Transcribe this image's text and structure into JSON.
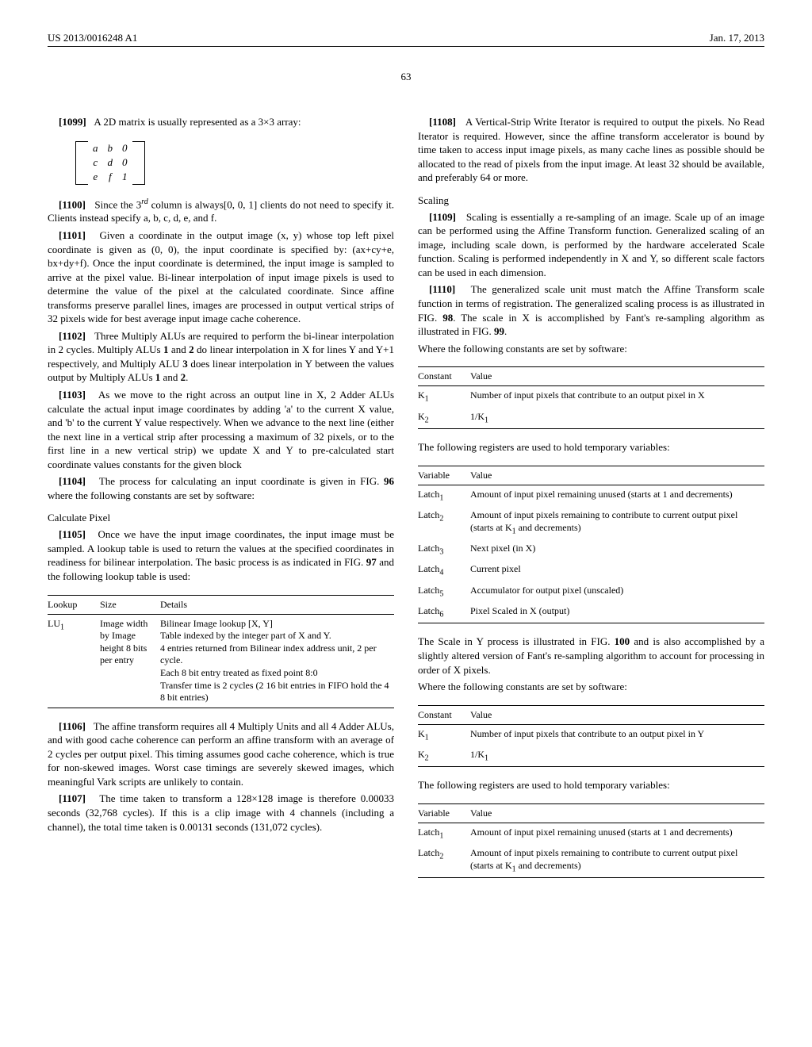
{
  "header": {
    "pub_number": "US 2013/0016248 A1",
    "pub_date": "Jan. 17, 2013",
    "page": "63"
  },
  "left": {
    "p1099": "A 2D matrix is usually represented as a 3×3 array:",
    "matrix": [
      [
        "a",
        "b",
        "0"
      ],
      [
        "c",
        "d",
        "0"
      ],
      [
        "e",
        "f",
        "1"
      ]
    ],
    "p1100": "Since the 3rd column is always[0, 0, 1] clients do not need to specify it. Clients instead specify a, b, c, d, e, and f.",
    "p1101": "Given a coordinate in the output image (x, y) whose top left pixel coordinate is given as (0, 0), the input coordinate is specified by: (ax+cy+e, bx+dy+f). Once the input coordinate is determined, the input image is sampled to arrive at the pixel value. Bi-linear interpolation of input image pixels is used to determine the value of the pixel at the calculated coordinate. Since affine transforms preserve parallel lines, images are processed in output vertical strips of 32 pixels wide for best average input image cache coherence.",
    "p1102": "Three Multiply ALUs are required to perform the bi-linear interpolation in 2 cycles. Multiply ALUs 1 and 2 do linear interpolation in X for lines Y and Y+1 respectively, and Multiply ALU 3 does linear interpolation in Y between the values output by Multiply ALUs 1 and 2.",
    "p1103": "As we move to the right across an output line in X, 2 Adder ALUs calculate the actual input image coordinates by adding 'a' to the current X value, and 'b' to the current Y value respectively. When we advance to the next line (either the next line in a vertical strip after processing a maximum of 32 pixels, or to the first line in a new vertical strip) we update X and Y to pre-calculated start coordinate values constants for the given block",
    "p1104": "The process for calculating an input coordinate is given in FIG. 96 where the following constants are set by software:",
    "calc_pixel_head": "Calculate Pixel",
    "p1105": "Once we have the input image coordinates, the input image must be sampled. A lookup table is used to return the values at the specified coordinates in readiness for bilinear interpolation. The basic process is as indicated in FIG. 97 and the following lookup table is used:",
    "lookup_table": {
      "headers": [
        "Lookup",
        "Size",
        "Details"
      ],
      "rows": [
        {
          "c1": "LU₁",
          "c2": "Image width by Image height 8 bits per entry",
          "c3": "Bilinear Image lookup [X, Y]\nTable indexed by the integer part of X and Y.\n4 entries returned from Bilinear index address unit, 2 per cycle.\nEach 8 bit entry treated as fixed point 8:0\nTransfer time is 2 cycles (2 16 bit entries in FIFO hold the 4 8 bit entries)"
        }
      ]
    },
    "p1106": "The affine transform requires all 4 Multiply Units and all 4 Adder ALUs, and with good cache coherence can perform an affine transform with an average of 2 cycles per output pixel. This timing assumes good cache coherence, which is true for non-skewed images. Worst case timings are severely skewed images, which meaningful Vark scripts are unlikely to contain.",
    "p1107": "The time taken to transform a 128×128 image is therefore 0.00033 seconds (32,768 cycles). If this is a clip image with 4 channels (including a channel), the total time taken is 0.00131 seconds (131,072 cycles)."
  },
  "right": {
    "p1108": "A Vertical-Strip Write Iterator is required to output the pixels. No Read Iterator is required. However, since the affine transform accelerator is bound by time taken to access input image pixels, as many cache lines as possible should be allocated to the read of pixels from the input image. At least 32 should be available, and preferably 64 or more.",
    "scaling_head": "Scaling",
    "p1109": "Scaling is essentially a re-sampling of an image. Scale up of an image can be performed using the Affine Transform function. Generalized scaling of an image, including scale down, is performed by the hardware accelerated Scale function. Scaling is performed independently in X and Y, so different scale factors can be used in each dimension.",
    "p1110": "The generalized scale unit must match the Affine Transform scale function in terms of registration. The generalized scaling process is as illustrated in FIG. 98. The scale in X is accomplished by Fant's re-sampling algorithm as illustrated in FIG. 99.",
    "const_intro1": "Where the following constants are set by software:",
    "const_table1": {
      "headers": [
        "Constant",
        "Value"
      ],
      "rows": [
        {
          "c1": "K₁",
          "c2": "Number of input pixels that contribute to an output pixel in X"
        },
        {
          "c1": "K₂",
          "c2": "1/K₁"
        }
      ]
    },
    "reg_intro1": "The following registers are used to hold temporary variables:",
    "var_table1": {
      "headers": [
        "Variable",
        "Value"
      ],
      "rows": [
        {
          "c1": "Latch₁",
          "c2": "Amount of input pixel remaining unused (starts at 1 and decrements)"
        },
        {
          "c1": "Latch₂",
          "c2": "Amount of input pixels remaining to contribute to current output pixel (starts at K₁ and decrements)"
        },
        {
          "c1": "Latch₃",
          "c2": "Next pixel (in X)"
        },
        {
          "c1": "Latch₄",
          "c2": "Current pixel"
        },
        {
          "c1": "Latch₅",
          "c2": "Accumulator for output pixel (unscaled)"
        },
        {
          "c1": "Latch₆",
          "c2": "Pixel Scaled in X (output)"
        }
      ]
    },
    "scale_y_text": "The Scale in Y process is illustrated in FIG. 100 and is also accomplished by a slightly altered version of Fant's re-sampling algorithm to account for processing in order of X pixels.",
    "const_intro2": "Where the following constants are set by software:",
    "const_table2": {
      "headers": [
        "Constant",
        "Value"
      ],
      "rows": [
        {
          "c1": "K₁",
          "c2": "Number of input pixels that contribute to an output pixel in Y"
        },
        {
          "c1": "K₂",
          "c2": "1/K₁"
        }
      ]
    },
    "reg_intro2": "The following registers are used to hold temporary variables:",
    "var_table2": {
      "headers": [
        "Variable",
        "Value"
      ],
      "rows": [
        {
          "c1": "Latch₁",
          "c2": "Amount of input pixel remaining unused (starts at 1 and decrements)"
        },
        {
          "c1": "Latch₂",
          "c2": "Amount of input pixels remaining to contribute to current output pixel (starts at K₁ and decrements)"
        }
      ]
    }
  }
}
